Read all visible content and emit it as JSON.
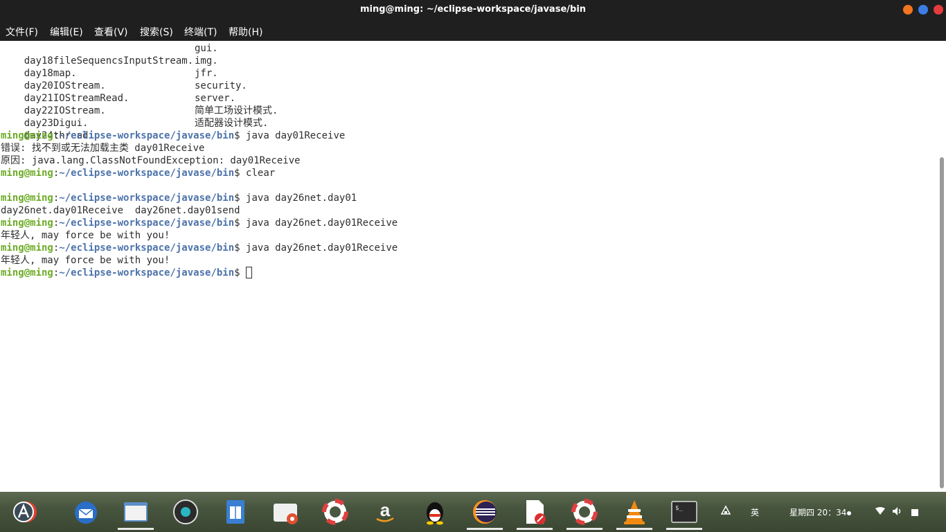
{
  "window": {
    "title": "ming@ming: ~/eclipse-workspace/javase/bin",
    "buttons": [
      {
        "name": "minimize",
        "color": "#f47421"
      },
      {
        "name": "maximize",
        "color": "#3b7de5"
      },
      {
        "name": "close",
        "color": "#e43c3c"
      }
    ]
  },
  "menu": {
    "items": [
      "文件(F)",
      "编辑(E)",
      "查看(V)",
      "搜索(S)",
      "终端(T)",
      "帮助(H)"
    ]
  },
  "terminal": {
    "listing": [
      {
        "left": "day18fileSequencsInputStream.",
        "right": "gui."
      },
      {
        "left": "day18map.",
        "right": "img."
      },
      {
        "left": "day20IOStream.",
        "right": "jfr."
      },
      {
        "left": "day21IOStreamRead.",
        "right": "security."
      },
      {
        "left": "day22IOStream.",
        "right": "server."
      },
      {
        "left": "day23Digui.",
        "right": "简单工场设计模式."
      },
      {
        "left": "day24thread.",
        "right": "适配器设计模式."
      }
    ],
    "prompt_user": "ming@ming",
    "prompt_colon": ":",
    "prompt_path": "~/eclipse-workspace/javase/bin",
    "prompt_dollar": "$ ",
    "cmd1": "java day01Receive",
    "err1": "错误: 找不到或无法加载主类 day01Receive",
    "err2": "原因: java.lang.ClassNotFoundException: day01Receive",
    "cmd2": "clear",
    "cmd3": "java day26net.day01",
    "completion": "day26net.day01Receive  day26net.day01send",
    "cmd4": "java day26net.day01Receive",
    "out4": "年轻人, may force be with you!",
    "cmd5": "java day26net.day01Receive",
    "out5": "年轻人, may force be with you!"
  },
  "taskbar": {
    "apps": [
      {
        "name": "app-switcher-icon",
        "colors": [
          "#e04030",
          "#ffffff"
        ]
      },
      {
        "name": "thunderbird-icon",
        "colors": [
          "#2a6ec7",
          "#ffffff"
        ]
      },
      {
        "name": "files-icon",
        "colors": [
          "#5b8ec9",
          "#f2f2f2"
        ]
      },
      {
        "name": "rhythmbox-icon",
        "colors": [
          "#2b2b2b",
          "#2bb6c4"
        ]
      },
      {
        "name": "libreoffice-writer-icon",
        "colors": [
          "#3a7fd1",
          "#ffffff"
        ]
      },
      {
        "name": "software-center-icon",
        "colors": [
          "#f0f0f0",
          "#e05030"
        ]
      },
      {
        "name": "help-icon",
        "colors": [
          "#ffffff",
          "#e04040"
        ]
      },
      {
        "name": "amazon-icon",
        "colors": [
          "#1a1a1a",
          "#f39a1e"
        ]
      },
      {
        "name": "qq-icon",
        "colors": [
          "#111111",
          "#ffcc00"
        ]
      },
      {
        "name": "eclipse-icon",
        "colors": [
          "#2c2255",
          "#f7941e"
        ]
      },
      {
        "name": "text-editor-icon",
        "colors": [
          "#ffffff",
          "#d83030"
        ]
      },
      {
        "name": "help-icon",
        "colors": [
          "#ffffff",
          "#e04040"
        ]
      },
      {
        "name": "vlc-icon",
        "colors": [
          "#f28a12",
          "#ffffff"
        ]
      },
      {
        "name": "terminal-icon",
        "colors": [
          "#2b2b2b",
          "#dcdcdc"
        ]
      }
    ],
    "tray": {
      "input_method": "英",
      "clock": "星期四 20：34"
    }
  }
}
